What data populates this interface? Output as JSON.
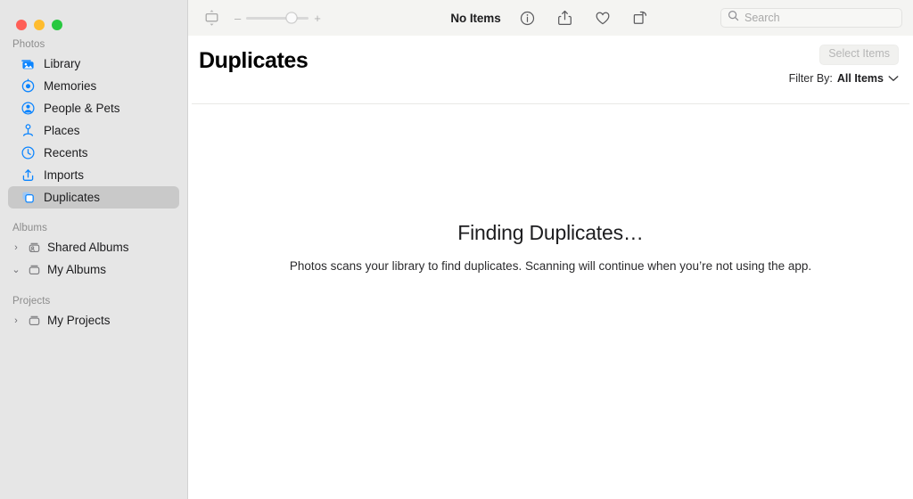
{
  "window": {
    "traffic_lights": [
      {
        "name": "close",
        "color": "#ff5f57"
      },
      {
        "name": "minimize",
        "color": "#febc2e"
      },
      {
        "name": "maximize",
        "color": "#28c840"
      }
    ]
  },
  "toolbar": {
    "view_toggle_icon": "view-options-icon",
    "zoom": {
      "minus_label": "–",
      "plus_label": "+",
      "value_percent": 73
    },
    "status_label": "No Items",
    "actions": [
      {
        "name": "info-icon",
        "label": "Info"
      },
      {
        "name": "share-icon",
        "label": "Share"
      },
      {
        "name": "favorite-heart-icon",
        "label": "Favorite"
      },
      {
        "name": "rotate-icon",
        "label": "Rotate"
      }
    ],
    "search": {
      "placeholder": "Search",
      "value": "",
      "icon": "search-icon"
    }
  },
  "sidebar": {
    "sections": [
      {
        "title": "Photos",
        "items": [
          {
            "label": "Library",
            "icon": "photos-library-icon",
            "selected": false
          },
          {
            "label": "Memories",
            "icon": "memories-icon",
            "selected": false
          },
          {
            "label": "People & Pets",
            "icon": "people-pets-icon",
            "selected": false
          },
          {
            "label": "Places",
            "icon": "places-pin-icon",
            "selected": false
          },
          {
            "label": "Recents",
            "icon": "recents-clock-icon",
            "selected": false
          },
          {
            "label": "Imports",
            "icon": "imports-icon",
            "selected": false
          },
          {
            "label": "Duplicates",
            "icon": "duplicates-icon",
            "selected": true
          }
        ]
      },
      {
        "title": "Albums",
        "items": [
          {
            "label": "Shared Albums",
            "icon": "shared-album-folder-icon",
            "chevron": "›",
            "expanded": false
          },
          {
            "label": "My Albums",
            "icon": "album-folder-icon",
            "chevron": "⌄",
            "expanded": true
          }
        ]
      },
      {
        "title": "Projects",
        "items": [
          {
            "label": "My Projects",
            "icon": "project-folder-icon",
            "chevron": "›",
            "expanded": false
          }
        ]
      }
    ]
  },
  "main": {
    "title": "Duplicates",
    "select_items_label": "Select Items",
    "filter": {
      "label": "Filter By:",
      "value": "All Items",
      "chevron_icon": "chevron-down-icon"
    },
    "empty_state": {
      "title": "Finding Duplicates…",
      "subtitle": "Photos scans your library to find duplicates. Scanning will continue when you’re not using the app."
    }
  },
  "colors": {
    "sidebar_bg": "#e6e6e6",
    "toolbar_bg": "#f4f4f2",
    "content_bg": "#ffffff",
    "accent_blue": "#0a84ff",
    "selected_row": "#c9c9c9"
  }
}
